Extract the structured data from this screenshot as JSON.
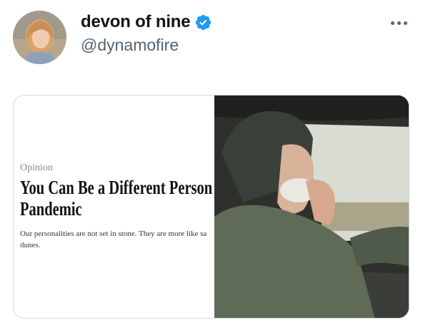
{
  "tweet": {
    "display_name": "devon of nine",
    "handle": "@dynamofire",
    "verified": true,
    "accent_color": "#1d9bf0",
    "more_icon": "more-horizontal-icon"
  },
  "media": {
    "article": {
      "section": "Opinion",
      "headline_line1": "You Can Be a Different Person Aft",
      "headline_line2": "Pandemic",
      "summary_line1": "Our personalities are not set in stone. They are more like sa",
      "summary_line2": "dunes."
    }
  }
}
